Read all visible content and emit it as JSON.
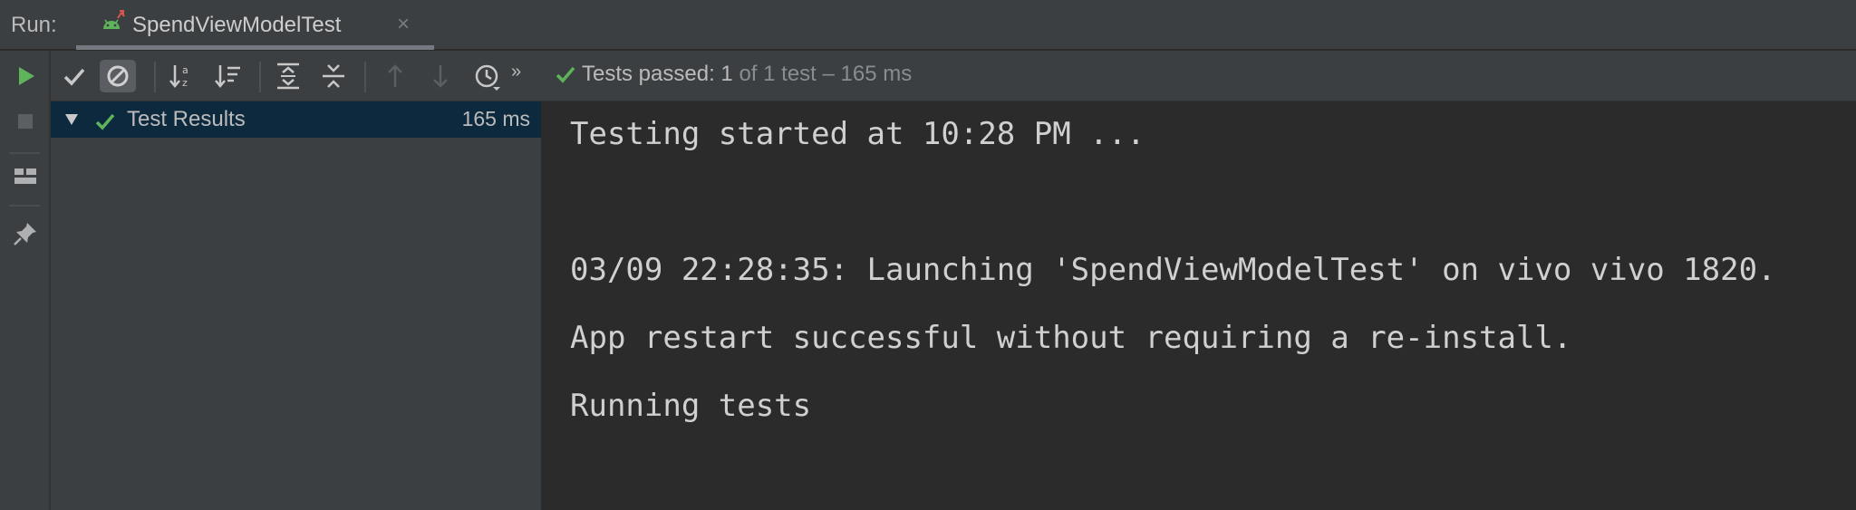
{
  "header": {
    "run_label": "Run:",
    "tab_title": "SpendViewModelTest",
    "tab_icon": "android-test-icon",
    "close_glyph": "×"
  },
  "left_toolbar": {
    "buttons": [
      "rerun-icon",
      "stop-icon",
      "layout-icon",
      "pin-icon"
    ]
  },
  "toolbar": {
    "buttons": [
      "show-passed-icon",
      "show-ignored-icon",
      "sort-alphabetically-icon",
      "sort-by-duration-icon",
      "expand-all-icon",
      "collapse-all-icon",
      "previous-failed-icon",
      "next-failed-icon",
      "test-history-icon",
      "more-chevron-icon"
    ],
    "more_glyph": "»"
  },
  "status": {
    "label": "Tests passed: ",
    "count": "1",
    "rest": " of 1 test – 165 ms"
  },
  "tree": {
    "root_label": "Test Results",
    "root_time": "165 ms"
  },
  "console": {
    "lines": [
      "Testing started at 10:28 PM ...",
      "03/09 22:28:35: Launching 'SpendViewModelTest' on vivo vivo 1820.",
      "App restart successful without requiring a re-install.",
      "Running tests"
    ]
  },
  "colors": {
    "accent_green": "#5fb35b",
    "selection": "#0d293e",
    "panel": "#3c3f41",
    "console_bg": "#2b2b2b"
  }
}
